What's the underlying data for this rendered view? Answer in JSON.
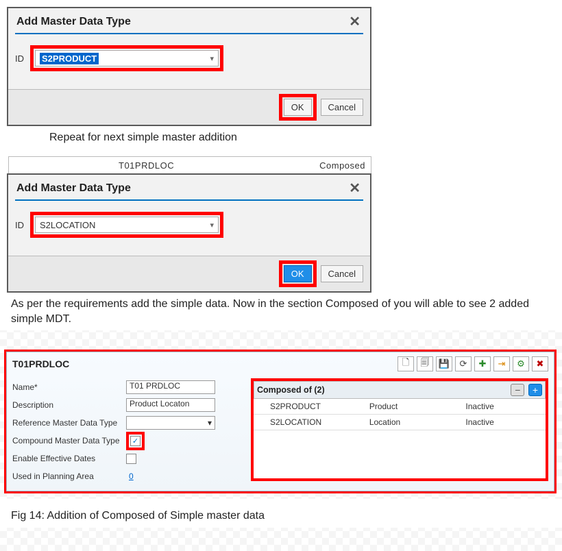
{
  "dialog1": {
    "title": "Add Master Data Type",
    "id_label": "ID",
    "value": "S2PRODUCT",
    "ok": "OK",
    "cancel": "Cancel"
  },
  "caption1": "Repeat for next simple master addition",
  "peek_row": {
    "a": "T01PRDLOC",
    "b": "Composed"
  },
  "dialog2": {
    "title": "Add Master Data Type",
    "id_label": "ID",
    "value": "S2LOCATION",
    "ok": "OK",
    "cancel": "Cancel"
  },
  "text_block": "As per the requirements add the simple data. Now in the section Composed of you will able to see 2 added simple MDT.",
  "detail": {
    "header": "T01PRDLOC",
    "form": {
      "name_label": "Name*",
      "name_value": "T01 PRDLOC",
      "desc_label": "Description",
      "desc_value": "Product Locaton",
      "ref_label": "Reference Master Data Type",
      "compound_label": "Compound Master Data Type",
      "compound_checked": "✓",
      "eff_label": "Enable Effective Dates",
      "plan_label": "Used in Planning Area",
      "plan_value": "0"
    },
    "composed": {
      "title": "Composed of  (2)",
      "rows": [
        {
          "id": "S2PRODUCT",
          "name": "Product",
          "status": "Inactive"
        },
        {
          "id": "S2LOCATION",
          "name": "Location",
          "status": "Inactive"
        }
      ]
    }
  },
  "fig_caption": "Fig  14: Addition of Composed of Simple master data"
}
